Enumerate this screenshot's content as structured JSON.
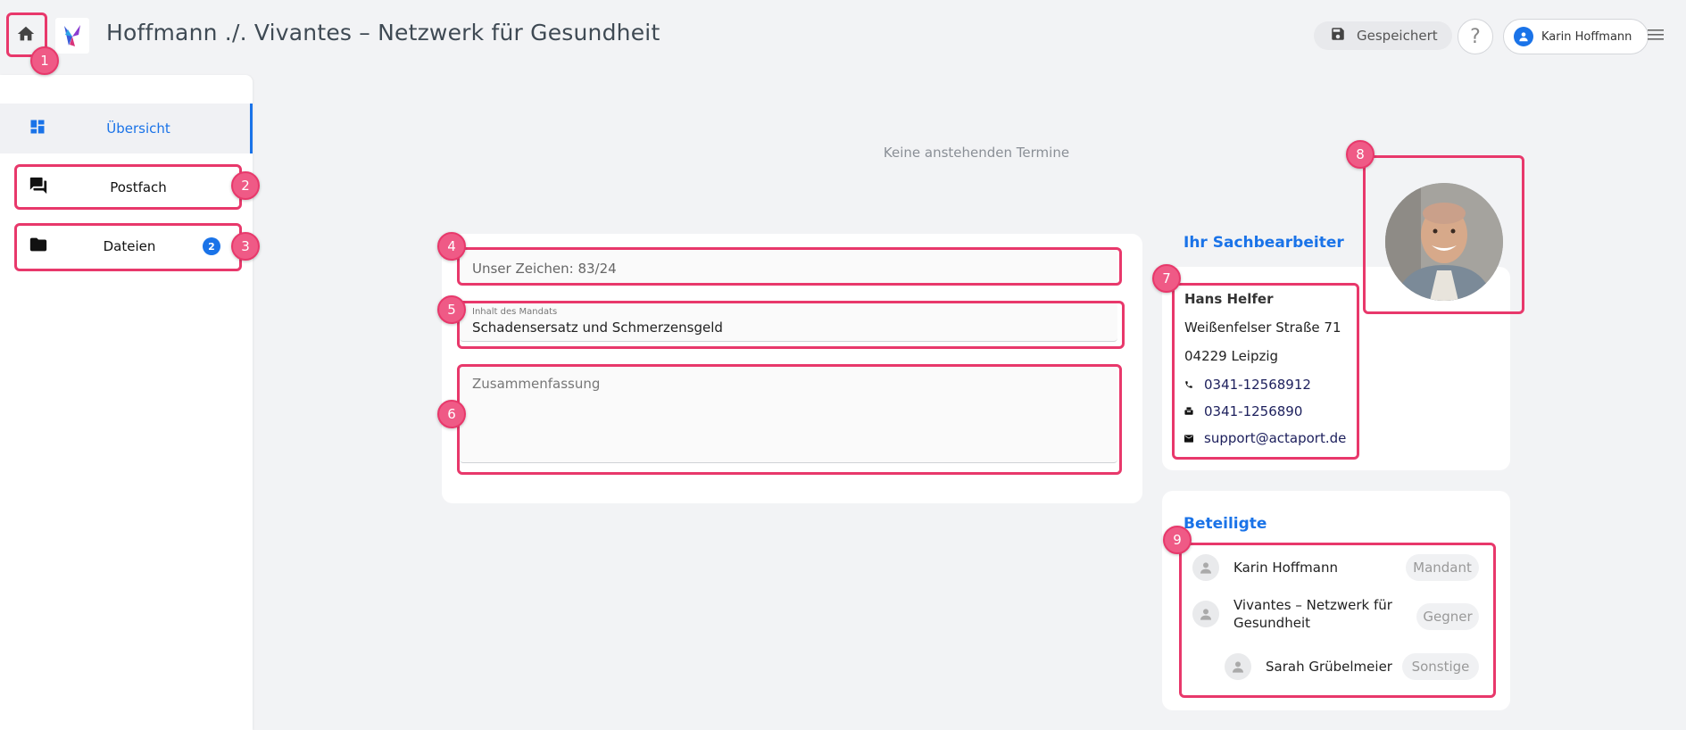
{
  "header": {
    "title": "Hoffmann ./. Vivantes – Netzwerk für Gesundheit",
    "saved_label": "Gespeichert",
    "help_label": "?",
    "user_name": "Karin Hoffmann"
  },
  "sidebar": {
    "items": [
      {
        "label": "Übersicht",
        "icon": "dashboard-icon",
        "active": true
      },
      {
        "label": "Postfach",
        "icon": "forum-icon"
      },
      {
        "label": "Dateien",
        "icon": "folder-icon",
        "badge": "2"
      }
    ]
  },
  "main": {
    "no_appointments": "Keine anstehenden Termine",
    "reference": "Unser Zeichen: 83/24",
    "content_label": "Inhalt des Mandats",
    "content_value": "Schadensersatz und Schmerzensgeld",
    "summary_placeholder": "Zusammenfassung"
  },
  "sachbearbeiter": {
    "title": "Ihr Sachbearbeiter",
    "name": "Hans Helfer",
    "street": "Weißenfelser Straße 71",
    "city": "04229 Leipzig",
    "phone": "0341-12568912",
    "fax": "0341-1256890",
    "email": "support@actaport.de"
  },
  "beteiligte": {
    "title": "Beteiligte",
    "parties": [
      {
        "name": "Karin Hoffmann",
        "role": "Mandant"
      },
      {
        "name_line1": "Vivantes – Netzwerk für",
        "name_line2": "Gesundheit",
        "role": "Gegner"
      },
      {
        "name": "Sarah Grübelmeier",
        "role": "Sonstige"
      }
    ]
  },
  "annotations": [
    "1",
    "2",
    "3",
    "4",
    "5",
    "6",
    "7",
    "8",
    "9"
  ],
  "colors": {
    "accent": "#1a73e8",
    "highlight": "#e8386b",
    "background": "#f2f3f5"
  }
}
